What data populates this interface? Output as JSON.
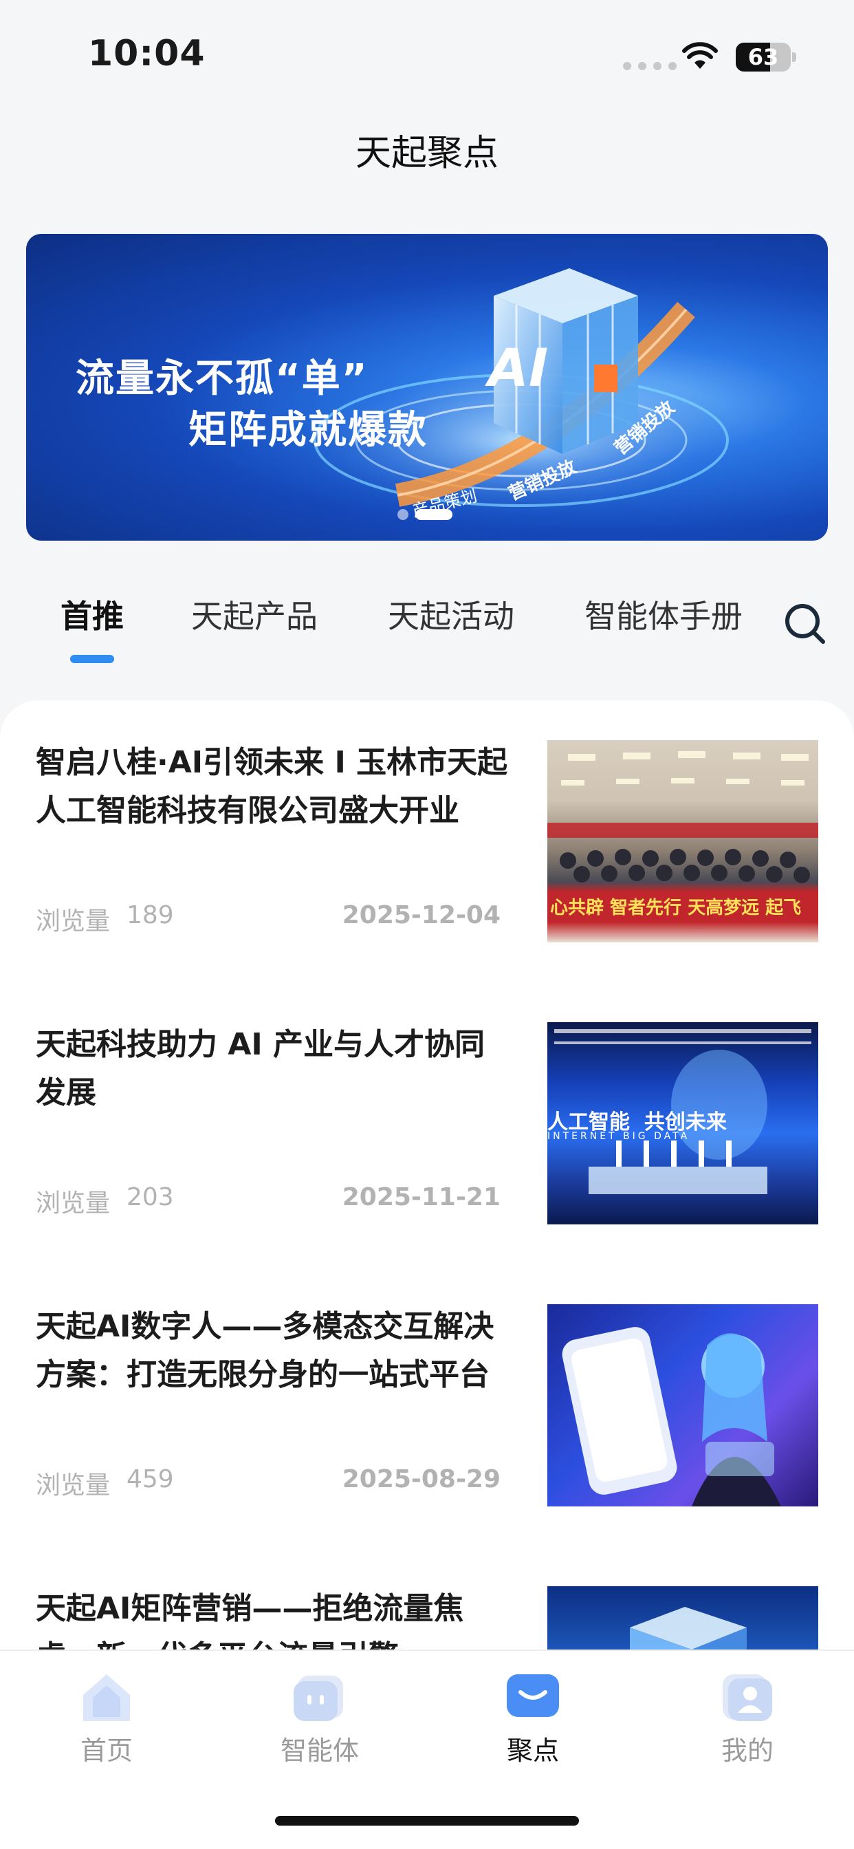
{
  "status_bar": {
    "time": "10:04",
    "battery_level": "63",
    "battery_fraction": 0.63
  },
  "header": {
    "title": "天起聚点"
  },
  "banner": {
    "line1": "流量永不孤“单”",
    "line2": "矩阵成就爆款",
    "cube_label": "AI",
    "ring_labels": [
      "产品策划",
      "营销投放",
      "营销投放"
    ],
    "slide_count": 2,
    "active_slide": 1
  },
  "tabs": [
    {
      "label": "首推",
      "active": true
    },
    {
      "label": "天起产品",
      "active": false
    },
    {
      "label": "天起活动",
      "active": false
    },
    {
      "label": "智能体手册",
      "active": false
    }
  ],
  "feed": {
    "views_label": "浏览量",
    "items": [
      {
        "title": "智启八桂·AI引领未来 I 玉林市天起人工智能科技有限公司盛大开业",
        "views": "189",
        "date": "2025-12-04",
        "thumb": "group-photo"
      },
      {
        "title": "天起科技助力 AI 产业与人才协同发展",
        "views": "203",
        "date": "2025-11-21",
        "thumb": "ai-stage"
      },
      {
        "title": "天起AI数字人——多模态交互解决方案：打造无限分身的一站式平台",
        "views": "459",
        "date": "2025-08-29",
        "thumb": "digital-human"
      },
      {
        "title": "天起AI矩阵营销——拒绝流量焦虑，新一代多平台流量引擎",
        "views": "",
        "date": "",
        "thumb": "cube"
      }
    ],
    "thumb_texts": {
      "banner_red": "心共辟 智者先行 天高梦远 起飞",
      "stage_a": "人工智能",
      "stage_b": "共创未来",
      "stage_c": "INTERNET BIG DATA"
    }
  },
  "bottom_nav": [
    {
      "label": "首页",
      "icon": "home-icon",
      "active": false
    },
    {
      "label": "智能体",
      "icon": "agent-icon",
      "active": false
    },
    {
      "label": "聚点",
      "icon": "mail-icon",
      "active": true
    },
    {
      "label": "我的",
      "icon": "profile-icon",
      "active": false
    }
  ],
  "colors": {
    "accent": "#2f8cf0",
    "background": "#f5f6f8",
    "muted_text": "#b2b2b2"
  }
}
